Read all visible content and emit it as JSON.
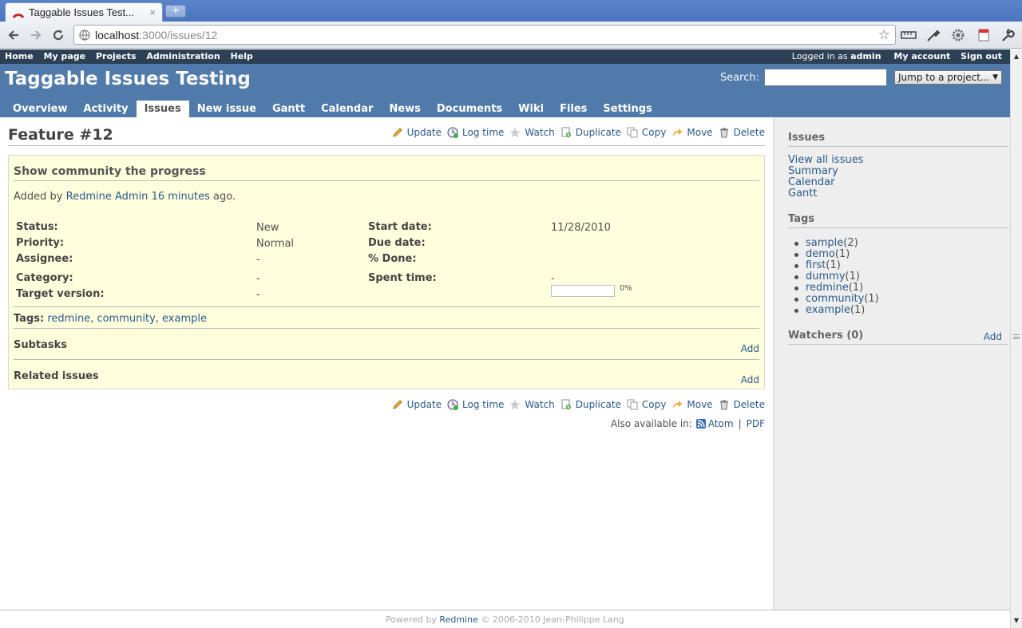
{
  "browser": {
    "tab_title": "Taggable Issues Test...",
    "tab_close": "×",
    "new_tab": "+",
    "url_host": "localhost",
    "url_path": ":3000/issues/12"
  },
  "top_menu": {
    "left": [
      "Home",
      "My page",
      "Projects",
      "Administration",
      "Help"
    ],
    "logged_in_prefix": "Logged in as",
    "logged_in_user": "admin",
    "my_account": "My account",
    "sign_out": "Sign out"
  },
  "header": {
    "project_title": "Taggable Issues Testing",
    "search_label": "Search:",
    "search_value": "",
    "jump_label": "Jump to a project...",
    "jump_arrow": "▼"
  },
  "main_menu": [
    "Overview",
    "Activity",
    "Issues",
    "New issue",
    "Gantt",
    "Calendar",
    "News",
    "Documents",
    "Wiki",
    "Files",
    "Settings"
  ],
  "issue": {
    "title": "Feature #12",
    "actions": [
      "Update",
      "Log time",
      "Watch",
      "Duplicate",
      "Copy",
      "Move",
      "Delete"
    ],
    "subject": "Show community the progress",
    "added_by": "Added by",
    "author": "Redmine Admin",
    "time_ago": "16 minutes",
    "ago": "ago.",
    "attributes": {
      "status_label": "Status:",
      "status": "New",
      "priority_label": "Priority:",
      "priority": "Normal",
      "assignee_label": "Assignee:",
      "assignee": "-",
      "category_label": "Category:",
      "category": "-",
      "target_label": "Target version:",
      "target": "-",
      "start_label": "Start date:",
      "start": "11/28/2010",
      "due_label": "Due date:",
      "due": "",
      "done_label": "% Done:",
      "done": "0%",
      "done_fraction": 0,
      "spent_label": "Spent time:",
      "spent": "-"
    },
    "tags_label": "Tags:",
    "tags": [
      "redmine",
      "community",
      "example"
    ],
    "subtasks": "Subtasks",
    "related": "Related issues",
    "add": "Add",
    "also_available": "Also available in:",
    "atom": "Atom",
    "separator": "|",
    "pdf": "PDF"
  },
  "sidebar": {
    "issues_heading": "Issues",
    "issue_links": [
      "View all issues",
      "Summary",
      "Calendar",
      "Gantt"
    ],
    "tags_heading": "Tags",
    "tags": [
      {
        "name": "sample",
        "count": "(2)"
      },
      {
        "name": "demo",
        "count": "(1)"
      },
      {
        "name": "first",
        "count": "(1)"
      },
      {
        "name": "dummy",
        "count": "(1)"
      },
      {
        "name": "redmine",
        "count": "(1)"
      },
      {
        "name": "community",
        "count": "(1)"
      },
      {
        "name": "example",
        "count": "(1)"
      }
    ],
    "watchers_heading": "Watchers (0)",
    "watchers_add": "Add"
  },
  "footer": {
    "powered_by": "Powered by",
    "redmine": "Redmine",
    "copyright": "© 2006-2010 Jean-Philippe Lang"
  },
  "colors": {
    "header_bg": "#507aaa",
    "top_menu_bg": "#2c4056",
    "issue_bg": "#ffffdd",
    "link": "#2a5a8a",
    "sidebar_bg": "#eeeeee"
  }
}
